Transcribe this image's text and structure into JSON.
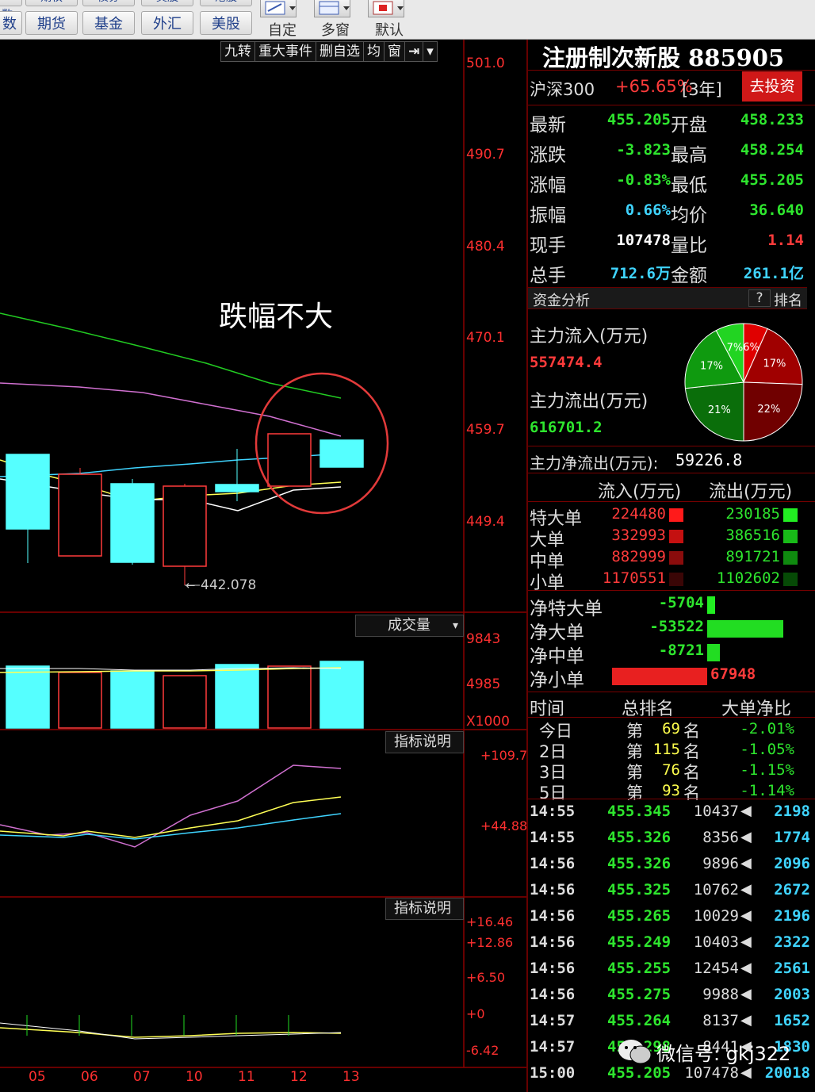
{
  "toolbar": {
    "row1_cut": [
      "期权",
      "债券",
      "美股",
      "港股"
    ],
    "row2": [
      "期货",
      "基金",
      "外汇",
      "美股"
    ],
    "left_cut": "数",
    "icon_labels": [
      "自定",
      "多窗",
      "默认"
    ]
  },
  "chart_tools": [
    "九转",
    "重大事件",
    "删自选",
    "均",
    "窗"
  ],
  "price_axis": [
    "501.0",
    "490.7",
    "480.4",
    "470.1",
    "459.7",
    "449.4"
  ],
  "annotation": "跌幅不大",
  "low_label": "442.078",
  "volume": {
    "label": "成交量",
    "axis": [
      "9843",
      "4985",
      "X1000"
    ]
  },
  "indicator1": {
    "label": "指标说明",
    "axis": [
      "+109.7",
      "+44.88"
    ]
  },
  "indicator2": {
    "label": "指标说明",
    "axis": [
      "+16.46",
      "+12.86",
      "+6.50",
      "+0",
      "-6.42"
    ]
  },
  "x_axis": [
    "05",
    "06",
    "07",
    "10",
    "11",
    "12",
    "13"
  ],
  "panel": {
    "title": "注册制次新股 885905",
    "hs300": {
      "label": "沪深300",
      "value": "+65.65%",
      "period": "[3年]",
      "button": "去投资"
    },
    "quote": [
      {
        "k1": "最新",
        "v1": "455.205",
        "k2": "开盘",
        "v2": "458.233"
      },
      {
        "k1": "涨跌",
        "v1": "-3.823",
        "k2": "最高",
        "v2": "458.254"
      },
      {
        "k1": "涨幅",
        "v1": "-0.83%",
        "k2": "最低",
        "v2": "455.205"
      },
      {
        "k1": "振幅",
        "v1": "0.66%",
        "k2": "均价",
        "v2": "36.640"
      },
      {
        "k1": "现手",
        "v1": "107478",
        "k2": "量比",
        "v2": "1.14"
      },
      {
        "k1": "总手",
        "v1": "712.6万",
        "k2": "金额",
        "v2": "261.1亿"
      }
    ],
    "fund": {
      "label": "资金分析",
      "help": "?",
      "rank": "排名",
      "inflow_label": "主力流入(万元)",
      "inflow": "557474.4",
      "outflow_label": "主力流出(万元)",
      "outflow": "616701.2",
      "net_label": "主力净流出(万元):",
      "net": "59226.8",
      "pie": [
        {
          "label": "6%",
          "value": 6,
          "color": "#e00000"
        },
        {
          "label": "17%",
          "value": 17,
          "color": "#a00000"
        },
        {
          "label": "22%",
          "value": 22,
          "color": "#700000"
        },
        {
          "label": "21%",
          "value": 21,
          "color": "#0a6e0a"
        },
        {
          "label": "17%",
          "value": 17,
          "color": "#0f9a0f"
        },
        {
          "label": "7%",
          "value": 7,
          "color": "#22d422"
        }
      ]
    },
    "flow_header": {
      "in": "流入(万元)",
      "out": "流出(万元)"
    },
    "flow_rows": [
      {
        "name": "特大单",
        "in": "224480",
        "out": "230185"
      },
      {
        "name": "大单",
        "in": "332993",
        "out": "386516"
      },
      {
        "name": "中单",
        "in": "882999",
        "out": "891721"
      },
      {
        "name": "小单",
        "in": "1170551",
        "out": "1102602"
      }
    ],
    "net_rows": [
      {
        "name": "净特大单",
        "value": "-5704"
      },
      {
        "name": "净大单",
        "value": "-53522"
      },
      {
        "name": "净中单",
        "value": "-8721"
      },
      {
        "name": "净小单",
        "value": "67948"
      }
    ],
    "rank_header": {
      "time": "时间",
      "rank": "总排名",
      "ratio": "大单净比"
    },
    "rank_rows": [
      {
        "day": "今日",
        "prefix": "第",
        "rank": "69",
        "suffix": "名",
        "ratio": "-2.01%"
      },
      {
        "day": "2日",
        "prefix": "第",
        "rank": "115",
        "suffix": "名",
        "ratio": "-1.05%"
      },
      {
        "day": "3日",
        "prefix": "第",
        "rank": "76",
        "suffix": "名",
        "ratio": "-1.15%"
      },
      {
        "day": "5日",
        "prefix": "第",
        "rank": "93",
        "suffix": "名",
        "ratio": "-1.14%"
      }
    ],
    "ticks": [
      {
        "time": "14:55",
        "price": "455.345",
        "vol": "10437",
        "amt": "2198"
      },
      {
        "time": "14:55",
        "price": "455.326",
        "vol": "8356",
        "amt": "1774"
      },
      {
        "time": "14:56",
        "price": "455.326",
        "vol": "9896",
        "amt": "2096"
      },
      {
        "time": "14:56",
        "price": "455.325",
        "vol": "10762",
        "amt": "2672"
      },
      {
        "time": "14:56",
        "price": "455.265",
        "vol": "10029",
        "amt": "2196"
      },
      {
        "time": "14:56",
        "price": "455.249",
        "vol": "10403",
        "amt": "2322"
      },
      {
        "time": "14:56",
        "price": "455.255",
        "vol": "12454",
        "amt": "2561"
      },
      {
        "time": "14:56",
        "price": "455.275",
        "vol": "9988",
        "amt": "2003"
      },
      {
        "time": "14:57",
        "price": "455.264",
        "vol": "8137",
        "amt": "1652"
      },
      {
        "time": "14:57",
        "price": "455.298",
        "vol": "8441",
        "amt": "1830"
      },
      {
        "time": "15:00",
        "price": "455.205",
        "vol": "107478",
        "amt": "20018"
      }
    ]
  },
  "watermark": "微信号: gkj322",
  "colors": {
    "up": "#ff3b3b",
    "down": "#55ffff",
    "frame": "#8b0000"
  }
}
